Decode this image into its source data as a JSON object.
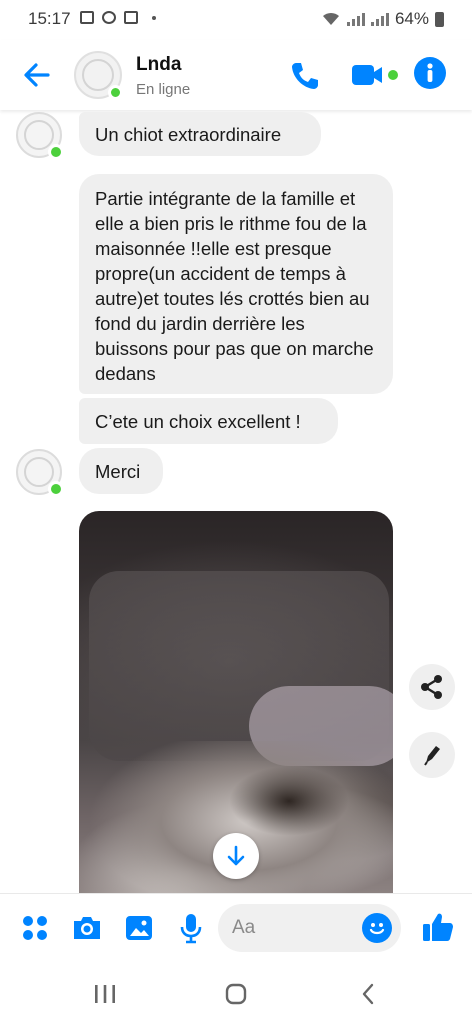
{
  "status_bar": {
    "time": "15:17",
    "battery": "64%"
  },
  "header": {
    "contact_name": "Lnda",
    "presence": "En ligne",
    "accent_color": "#0084ff",
    "online_color": "#4cd03c"
  },
  "messages": [
    {
      "text": "Un chiot extraordinaire"
    },
    {
      "text": "Partie intégrante de la famille et elle a bien pris le rithme fou de la maisonnée !!elle est presque propre(un accident de temps à autre)et toutes lés crottés bien au fond du jardin derrière les buissons pour pas que on marche dedans"
    },
    {
      "text": "C’ete un choix excellent !"
    },
    {
      "text": "Merci"
    }
  ],
  "composer": {
    "placeholder": "Aa"
  }
}
